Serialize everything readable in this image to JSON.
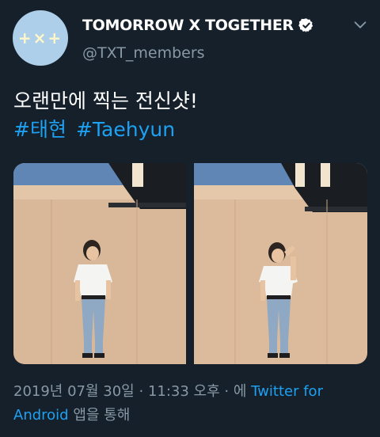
{
  "header": {
    "avatar_text": "+×+",
    "display_name": "TOMORROW X TOGETHER",
    "handle": "@TXT_members",
    "verified_icon": "verified-badge-icon",
    "menu_icon": "chevron-down-icon"
  },
  "tweet": {
    "text": "오랜만에 찍는 전신샷!",
    "hashtags": [
      "#태현",
      "#Taehyun"
    ]
  },
  "media": {
    "photo_count": 2
  },
  "meta": {
    "date": "2019년 07월 30일",
    "separator": "·",
    "time": "11:33 오후",
    "separator2": "·",
    "via_prefix": "에",
    "source_link": "Twitter for Android",
    "via_suffix": "앱을 통해"
  },
  "colors": {
    "background": "#15202b",
    "link": "#1da1f2",
    "secondary_text": "#8899a6"
  }
}
